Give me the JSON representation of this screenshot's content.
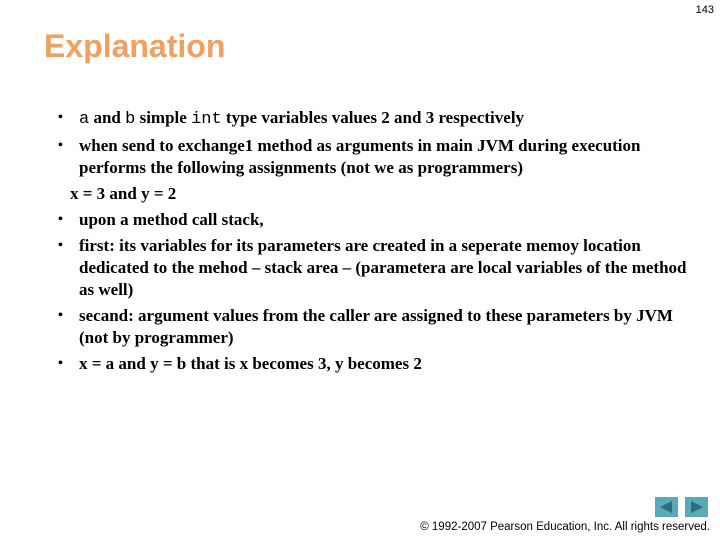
{
  "page_number": "143",
  "title": "Explanation",
  "content": {
    "b1": {
      "code_a": "a",
      "t1": " and ",
      "code_b": "b",
      "t2": " simple ",
      "code_int": "int",
      "t3": " type variables values 2 and 3 respectively"
    },
    "b2": "when send to exchange1 method as arguments in main JVM during execution performs the following assignments (not we as programmers)",
    "plain_line": "x = 3 and y = 2",
    "b3": "upon a method call stack,",
    "b4": "first: its variables for its parameters are created in a seperate memoy location dedicated to the mehod – stack area – (parametera are local variables of the method as well)",
    "b5": "secand: argument values from the caller are assigned to these parameters  by JVM (not by programmer)",
    "b6": "x = a and y = b that is x becomes 3, y becomes 2",
    "bullet_glyph": "•"
  },
  "nav": {
    "prev_icon": "triangle-left",
    "next_icon": "triangle-right"
  },
  "footer": "© 1992-2007 Pearson Education, Inc.  All rights reserved.",
  "colors": {
    "title": "#F0A060",
    "nav_button": "#5AA8B8",
    "nav_arrow": "#2E6E7E"
  }
}
